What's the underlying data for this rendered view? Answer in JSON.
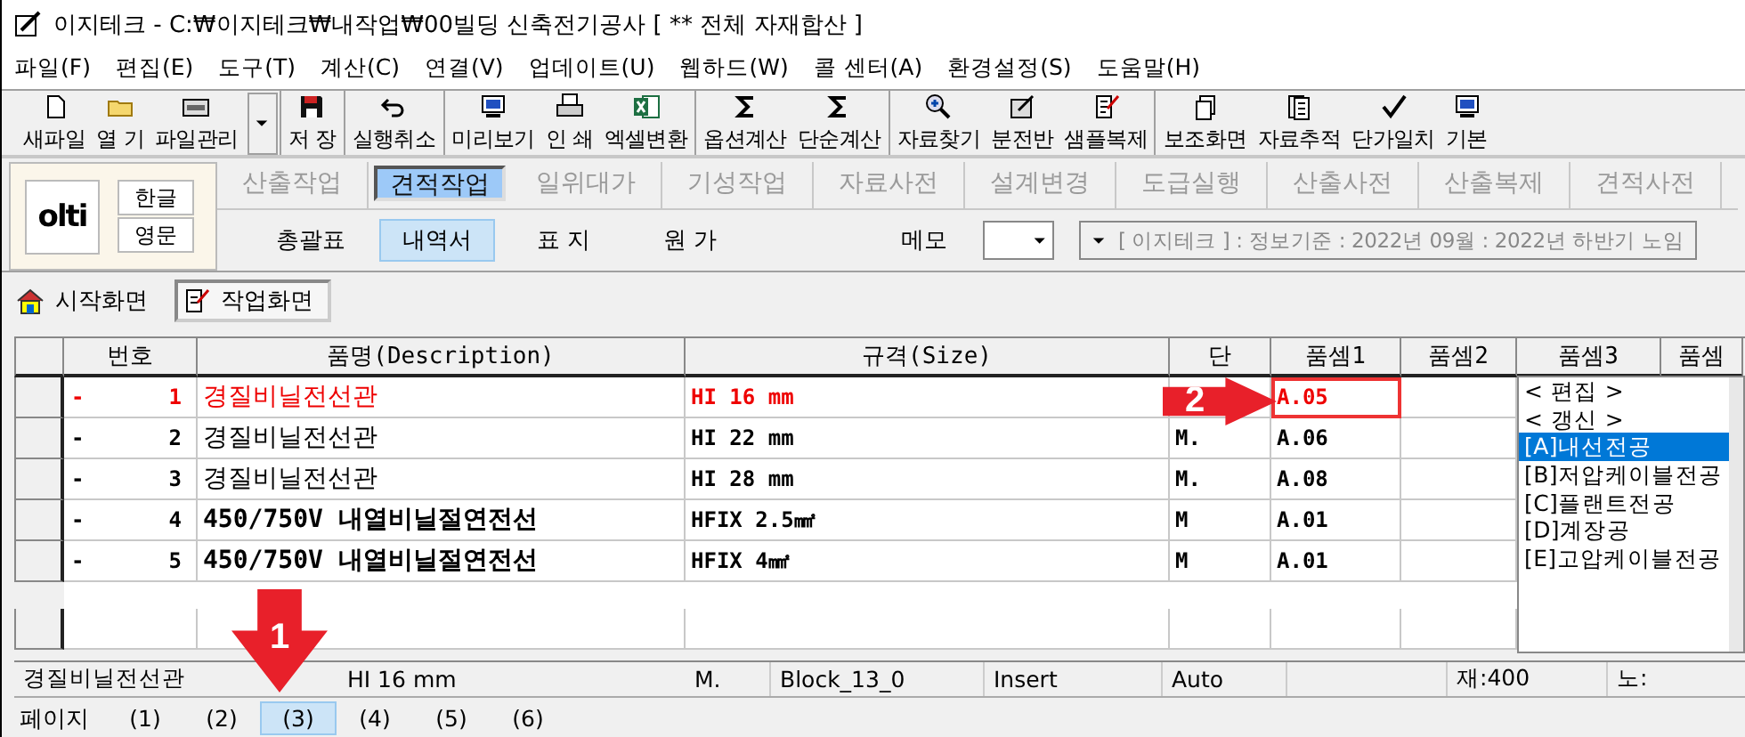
{
  "window": {
    "title": "이지테크 - C:₩이지테크₩내작업₩00빌딩 신축전기공사 [ ** 전체 자재합산 ]"
  },
  "menu": [
    "파일(F)",
    "편집(E)",
    "도구(T)",
    "계산(C)",
    "연결(V)",
    "업데이트(U)",
    "웹하드(W)",
    "콜 센터(A)",
    "환경설정(S)",
    "도움말(H)"
  ],
  "toolbar": [
    [
      {
        "label": "새파일",
        "kind": "button"
      },
      {
        "label": "열 기",
        "kind": "button"
      },
      {
        "label": "파일관리",
        "kind": "split"
      }
    ],
    [
      {
        "label": "저 장",
        "kind": "button"
      }
    ],
    [
      {
        "label": "실행취소",
        "kind": "button"
      }
    ],
    [
      {
        "label": "미리보기",
        "kind": "button"
      },
      {
        "label": "인 쇄",
        "kind": "button"
      },
      {
        "label": "엑셀변환",
        "kind": "button"
      }
    ],
    [
      {
        "label": "옵션계산",
        "kind": "button"
      },
      {
        "label": "단순계산",
        "kind": "button"
      }
    ],
    [
      {
        "label": "자료찾기",
        "kind": "button"
      },
      {
        "label": "분전반",
        "kind": "button"
      },
      {
        "label": "샘플복제",
        "kind": "button"
      }
    ],
    [
      {
        "label": "보조화면",
        "kind": "button"
      },
      {
        "label": "자료추적",
        "kind": "button"
      },
      {
        "label": "단가일치",
        "kind": "button"
      },
      {
        "label": "기본",
        "kind": "button"
      }
    ]
  ],
  "panel": {
    "logo": "olti",
    "language_buttons": [
      "한글",
      "영문"
    ],
    "work_tabs": [
      {
        "label": "산출작업",
        "selected": false
      },
      {
        "label": "견적작업",
        "selected": true
      },
      {
        "label": "일위대가",
        "selected": false
      },
      {
        "label": "기성작업",
        "selected": false
      },
      {
        "label": "자료사전",
        "selected": false
      },
      {
        "label": "설계변경",
        "selected": false
      },
      {
        "label": "도급실행",
        "selected": false
      },
      {
        "label": "산출사전",
        "selected": false
      },
      {
        "label": "산출복제",
        "selected": false
      },
      {
        "label": "견적사전",
        "selected": false
      }
    ],
    "sheet_tabs": [
      {
        "label": "총괄표",
        "selected": false
      },
      {
        "label": "내역서",
        "selected": true
      },
      {
        "label": "표 지",
        "selected": false
      },
      {
        "label": "원 가",
        "selected": false
      }
    ],
    "memo_label": "메모",
    "info": "[ 이지테크 ] : 정보기준 : 2022년 09월 : 2022년 하반기 노임"
  },
  "screen_tabs": [
    {
      "label": "시작화면",
      "selected": false
    },
    {
      "label": "작업화면",
      "selected": true
    }
  ],
  "table": {
    "columns": [
      "번호",
      "품명(Description)",
      "규격(Size)",
      "단",
      "품셈1",
      "품셈2",
      "품셈3",
      "품셈"
    ],
    "rows": [
      {
        "marker": "-",
        "number": "1",
        "name": "경질비닐전선관",
        "size": "HI 16 mm",
        "pumsem1": "A.05",
        "current": true,
        "editing": true
      },
      {
        "marker": "-",
        "number": "2",
        "name": "경질비닐전선관",
        "size": "HI 22 mm",
        "unit": "M.",
        "pumsem1": "A.06",
        "current": false,
        "editing": false
      },
      {
        "marker": "-",
        "number": "3",
        "name": "경질비닐전선관",
        "size": "HI 28 mm",
        "unit": "M.",
        "pumsem1": "A.08",
        "current": false,
        "editing": false
      },
      {
        "marker": "-",
        "number": "4",
        "name": "450/750V 내열비닐절연전선",
        "size": "HFIX 2.5㎟",
        "unit": "M",
        "pumsem1": "A.01",
        "current": false,
        "editing": false
      },
      {
        "marker": "-",
        "number": "5",
        "name": "450/750V 내열비닐절연전선",
        "size": "HFIX 4㎟",
        "unit": "M",
        "pumsem1": "A.01",
        "current": false,
        "editing": false
      }
    ]
  },
  "code_list": [
    {
      "label": "< 편집 >",
      "selected": false
    },
    {
      "label": "< 갱신 >",
      "selected": false
    },
    {
      "label": "[A]내선전공",
      "selected": true
    },
    {
      "label": "[B]저압케이블전공",
      "selected": false
    },
    {
      "label": "[C]플랜트전공",
      "selected": false
    },
    {
      "label": "[D]계장공",
      "selected": false
    },
    {
      "label": "[E]고압케이블전공",
      "selected": false
    }
  ],
  "status_bar": [
    "경질비닐전선관",
    "HI 16 mm",
    "M.",
    "Block_13_0",
    "Insert",
    "Auto",
    "재:400",
    "노:"
  ],
  "pages": {
    "label": "페이지",
    "items": [
      {
        "label": "(1)",
        "selected": false
      },
      {
        "label": "(2)",
        "selected": false
      },
      {
        "label": "(3)",
        "selected": true
      },
      {
        "label": "(4)",
        "selected": false
      },
      {
        "label": "(5)",
        "selected": false
      },
      {
        "label": "(6)",
        "selected": false
      }
    ]
  },
  "annotations": [
    {
      "label": "1"
    },
    {
      "label": "2"
    }
  ]
}
